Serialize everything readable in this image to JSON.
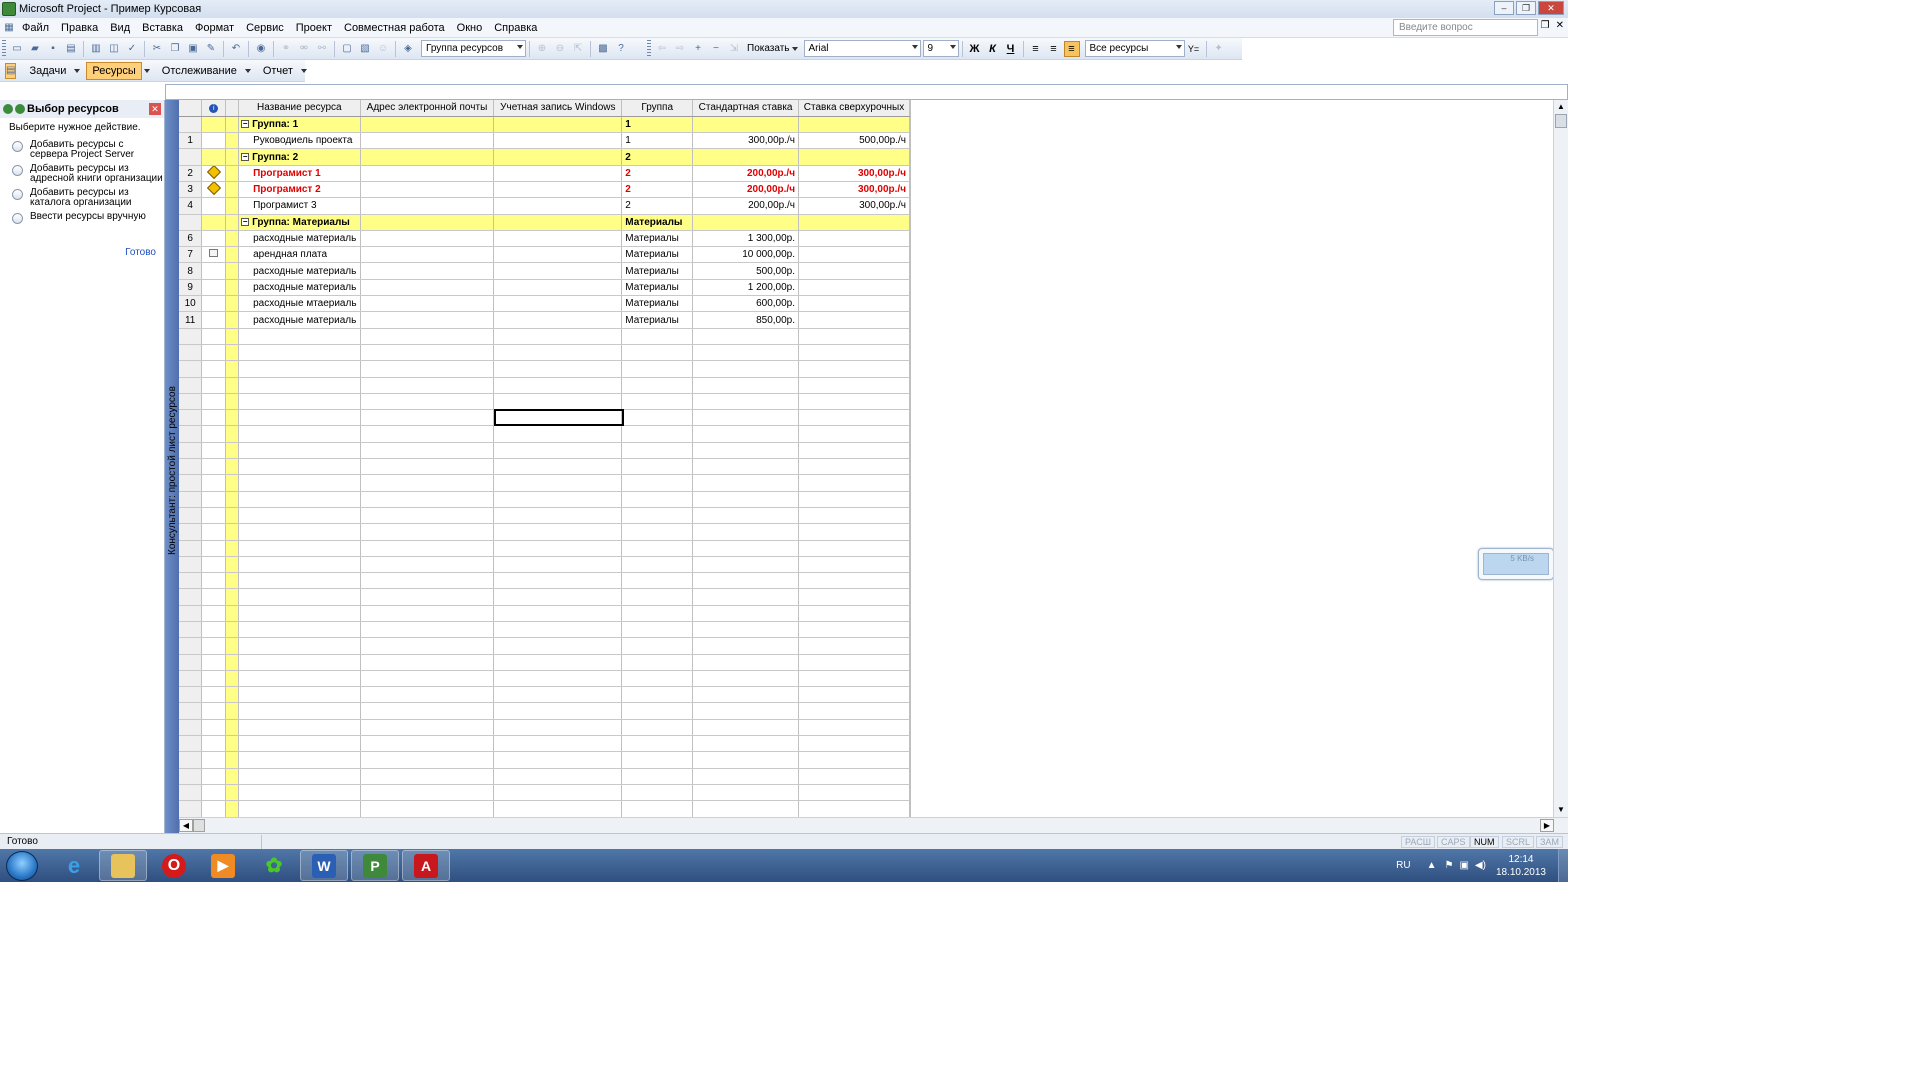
{
  "window": {
    "title": "Microsoft Project - Пример Курсовая",
    "min": "‒",
    "max": "❐",
    "close": "✕"
  },
  "menu": {
    "items": [
      "Файл",
      "Правка",
      "Вид",
      "Вставка",
      "Формат",
      "Сервис",
      "Проект",
      "Совместная работа",
      "Окно",
      "Справка"
    ],
    "question_placeholder": "Введите вопрос",
    "restore": "❐",
    "close": "✕"
  },
  "toolbar": {
    "group_combo": "Группа ресурсов",
    "show_label": "Показать",
    "font": "Arial",
    "size": "9",
    "bold": "Ж",
    "italic": "К",
    "underline": "Ч",
    "filter_combo": "Все ресурсы",
    "filter_icon": "Y="
  },
  "viewbar": {
    "tasks": "Задачи",
    "resources": "Ресурсы",
    "tracking": "Отслеживание",
    "report": "Отчет"
  },
  "sidepane": {
    "title": "Выбор ресурсов",
    "prompt": "Выберите нужное действие.",
    "options": [
      "Добавить ресурсы с сервера Project Server",
      "Добавить ресурсы из адресной книги организации",
      "Добавить ресурсы из каталога организации",
      "Ввести ресурсы вручную"
    ],
    "done": "Готово"
  },
  "consult_bar": "Консультант: простой лист ресурсов",
  "table": {
    "headers": {
      "info": "i",
      "name": "Название ресурса",
      "email": "Адрес электронной почты",
      "win": "Учетная запись Windows",
      "group": "Группа",
      "std": "Стандартная ставка",
      "ot": "Ставка сверхурочных"
    },
    "rows": [
      {
        "type": "group",
        "id": "",
        "name": "Группа: 1",
        "group": "1"
      },
      {
        "type": "res",
        "id": "1",
        "name": "Руководиель проекта",
        "group": "1",
        "std": "300,00р./ч",
        "ot": "500,00р./ч"
      },
      {
        "type": "group",
        "id": "",
        "name": "Группа: 2",
        "group": "2"
      },
      {
        "type": "red",
        "id": "2",
        "name": "Програмист 1",
        "group": "2",
        "std": "200,00р./ч",
        "ot": "300,00р./ч",
        "ind": "warn"
      },
      {
        "type": "red",
        "id": "3",
        "name": "Програмист 2",
        "group": "2",
        "std": "200,00р./ч",
        "ot": "300,00р./ч",
        "ind": "warn"
      },
      {
        "type": "res",
        "id": "4",
        "name": "Програмист 3",
        "group": "2",
        "std": "200,00р./ч",
        "ot": "300,00р./ч"
      },
      {
        "type": "group",
        "id": "",
        "name": "Группа: Материалы",
        "group": "Материалы"
      },
      {
        "type": "res",
        "id": "6",
        "name": "расходные материаль",
        "group": "Материалы",
        "std": "1 300,00р."
      },
      {
        "type": "res",
        "id": "7",
        "name": "арендная плата",
        "group": "Материалы",
        "std": "10 000,00р.",
        "ind": "note"
      },
      {
        "type": "res",
        "id": "8",
        "name": "расходные материаль",
        "group": "Материалы",
        "std": "500,00р."
      },
      {
        "type": "res",
        "id": "9",
        "name": "расходные материаль",
        "group": "Материалы",
        "std": "1 200,00р."
      },
      {
        "type": "res",
        "id": "10",
        "name": "расходные мтаериаль",
        "group": "Материалы",
        "std": "600,00р."
      },
      {
        "type": "res",
        "id": "11",
        "name": "расходные материаль",
        "group": "Материалы",
        "std": "850,00р."
      }
    ]
  },
  "network_widget": {
    "speed": "5 KB/s"
  },
  "status": {
    "text": "Готово",
    "indicators": [
      "РАСШ",
      "CAPS",
      "NUM",
      "SCRL",
      "ЗАМ"
    ],
    "active": "NUM"
  },
  "taskbar": {
    "lang": "RU",
    "time": "12:14",
    "date": "18.10.2013",
    "apps": [
      "internet-explorer",
      "file-explorer",
      "opera",
      "media-player",
      "icq",
      "word",
      "project",
      "acrobat"
    ]
  }
}
